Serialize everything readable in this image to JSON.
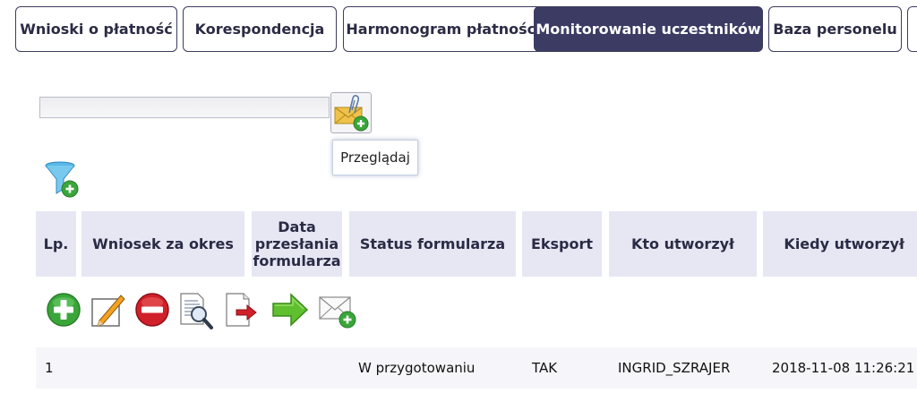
{
  "tabs": [
    {
      "label": "Wnioski o płatność",
      "active": false
    },
    {
      "label": "Korespondencja",
      "active": false
    },
    {
      "label": "Harmonogram płatności",
      "active": false
    },
    {
      "label": "Monitorowanie uczestników",
      "active": true
    },
    {
      "label": "Baza personelu",
      "active": false
    }
  ],
  "upload": {
    "file_value": "",
    "tooltip": "Przeglądaj"
  },
  "table": {
    "headers": [
      "Lp.",
      "Wniosek za okres",
      "Data przesłania formularza",
      "Status formularza",
      "Eksport",
      "Kto utworzył",
      "Kiedy utworzył"
    ],
    "header_lines": {
      "data_line1": "Data",
      "data_line2": "przesłania",
      "data_line3": "formularza"
    },
    "rows": [
      {
        "lp": "1",
        "wniosek": "",
        "data_przeslania": "",
        "status": "W przygotowaniu",
        "eksport": "TAK",
        "kto": "INGRID_SZRAJER",
        "kiedy": "2018-11-08 11:26:21"
      }
    ]
  },
  "toolbar": {
    "icons": [
      "add-icon",
      "edit-icon",
      "delete-icon",
      "preview-icon",
      "export-icon",
      "send-icon",
      "attach-mail-icon"
    ]
  },
  "colors": {
    "active_tab": "#3b3b63",
    "header_bg": "#e6e7f3",
    "row_bg": "#f6f6fa",
    "green": "#3aa63a",
    "red": "#d0202a"
  }
}
